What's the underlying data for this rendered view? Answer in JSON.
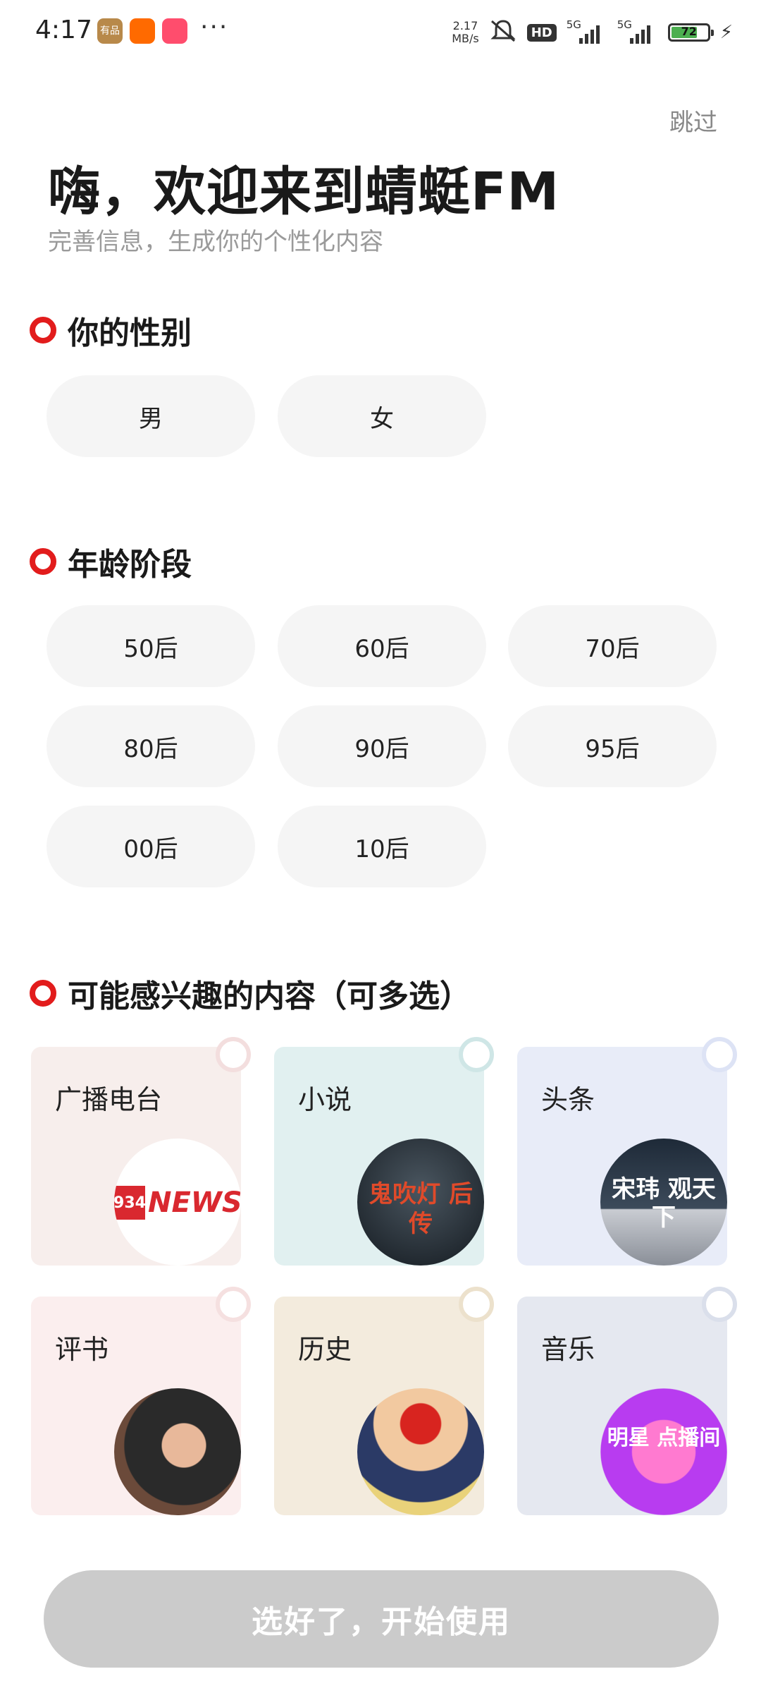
{
  "status_bar": {
    "time": "4:17",
    "app_icons": [
      {
        "name": "youpin-icon",
        "color": "#b8894a"
      },
      {
        "name": "taobao-icon",
        "color": "#ff6a00"
      },
      {
        "name": "pinduoduo-icon",
        "color": "#ff4d6d"
      }
    ],
    "more": "···",
    "speed_top": "2.17",
    "speed_unit": "MB/s",
    "hd": "HD",
    "net1": "5G",
    "net2": "5G",
    "battery": "72",
    "battery_level": 0.72
  },
  "header": {
    "skip": "跳过",
    "title": "嗨，欢迎来到蜻蜓FM",
    "subtitle": "完善信息，生成你的个性化内容"
  },
  "gender": {
    "label": "你的性别",
    "options": [
      "男",
      "女"
    ]
  },
  "age": {
    "label": "年龄阶段",
    "options": [
      "50后",
      "60后",
      "70后",
      "80后",
      "90后",
      "95后",
      "00后",
      "10后"
    ]
  },
  "interests": {
    "label": "可能感兴趣的内容（可多选）",
    "items": [
      {
        "label": "广播电台",
        "bg": "#f7eeec",
        "check": "#f3dede",
        "art": "NEWS"
      },
      {
        "label": "小说",
        "bg": "#e1f0f0",
        "check": "#cfe6e6",
        "art": "鬼吹灯 后传"
      },
      {
        "label": "头条",
        "bg": "#e8ecf8",
        "check": "#dde3f5",
        "art": "宋玮 观天下"
      },
      {
        "label": "评书",
        "bg": "#fbeeee",
        "check": "#f5e0e0",
        "art": ""
      },
      {
        "label": "历史",
        "bg": "#f3ebdd",
        "check": "#ece1cc",
        "art": ""
      },
      {
        "label": "音乐",
        "bg": "#e5e8f0",
        "check": "#dadfeb",
        "art": "明星 点播间"
      }
    ]
  },
  "footer": {
    "start_button": "选好了，开始使用"
  }
}
